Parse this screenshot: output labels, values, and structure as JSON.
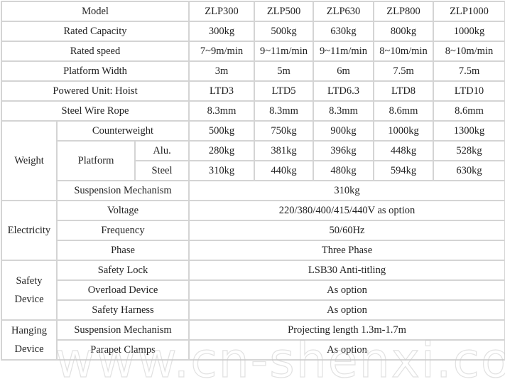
{
  "models": [
    "ZLP300",
    "ZLP500",
    "ZLP630",
    "ZLP800",
    "ZLP1000"
  ],
  "header": {
    "label": "Model"
  },
  "rows": {
    "rated_capacity": {
      "label": "Rated Capacity",
      "values": [
        "300kg",
        "500kg",
        "630kg",
        "800kg",
        "1000kg"
      ]
    },
    "rated_speed": {
      "label": "Rated speed",
      "values": [
        "7~9m/min",
        "9~11m/min",
        "9~11m/min",
        "8~10m/min",
        "8~10m/min"
      ]
    },
    "platform_width": {
      "label": "Platform Width",
      "values": [
        "3m",
        "5m",
        "6m",
        "7.5m",
        "7.5m"
      ]
    },
    "powered_unit": {
      "label": "Powered Unit: Hoist",
      "values": [
        "LTD3",
        "LTD5",
        "LTD6.3",
        "LTD8",
        "LTD10"
      ]
    },
    "steel_wire_rope": {
      "label": "Steel Wire Rope",
      "values": [
        "8.3mm",
        "8.3mm",
        "8.3mm",
        "8.6mm",
        "8.6mm"
      ]
    }
  },
  "weight": {
    "group_label": "Weight",
    "counterweight": {
      "label": "Counterweight",
      "values": [
        "500kg",
        "750kg",
        "900kg",
        "1000kg",
        "1300kg"
      ]
    },
    "platform": {
      "label": "Platform",
      "alu": {
        "label": "Alu.",
        "values": [
          "280kg",
          "381kg",
          "396kg",
          "448kg",
          "528kg"
        ]
      },
      "steel": {
        "label": "Steel",
        "values": [
          "310kg",
          "440kg",
          "480kg",
          "594kg",
          "630kg"
        ]
      }
    },
    "suspension": {
      "label": "Suspension Mechanism",
      "value": "310kg"
    }
  },
  "electricity": {
    "group_label": "Electricity",
    "voltage": {
      "label": "Voltage",
      "value": "220/380/400/415/440V as option"
    },
    "frequency": {
      "label": "Frequency",
      "value": "50/60Hz"
    },
    "phase": {
      "label": "Phase",
      "value": "Three Phase"
    }
  },
  "safety": {
    "group_label_line1": "Safety",
    "group_label_line2": "Device",
    "lock": {
      "label": "Safety Lock",
      "value": "LSB30 Anti-titling"
    },
    "overload": {
      "label": "Overload Device",
      "value": "As option"
    },
    "harness": {
      "label": "Safety Harness",
      "value": "As option"
    }
  },
  "hanging": {
    "group_label_line1": "Hanging",
    "group_label_line2": "Device",
    "suspension": {
      "label": "Suspension Mechanism",
      "value": "Projecting length 1.3m-1.7m"
    },
    "clamps": {
      "label": "Parapet Clamps",
      "value": "As option"
    }
  },
  "watermark": "www.cn-shenxi.com"
}
